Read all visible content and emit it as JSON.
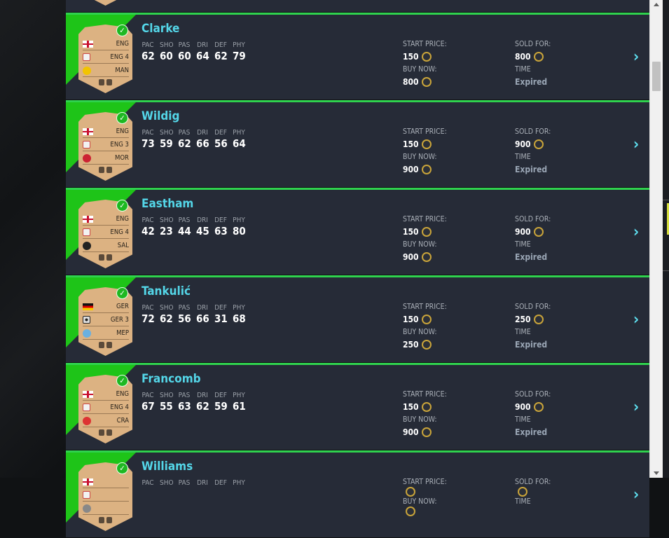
{
  "labels": {
    "stats": [
      "PAC",
      "SHO",
      "PAS",
      "DRI",
      "DEF",
      "PHY"
    ],
    "start_price": "START PRICE:",
    "buy_now": "BUY NOW:",
    "sold_for": "SOLD FOR:",
    "time": "TIME"
  },
  "players": [
    {
      "name": "",
      "nation": "",
      "league": "",
      "club": "",
      "stats": [
        "",
        "",
        "",
        "",
        "",
        ""
      ],
      "start": "",
      "buy": "",
      "sold": "",
      "time": ""
    },
    {
      "name": "Clarke",
      "nation": "ENG",
      "league": "ENG 4",
      "club": "MAN",
      "stats": [
        "62",
        "60",
        "60",
        "64",
        "62",
        "79"
      ],
      "start": "150",
      "buy": "800",
      "sold": "800",
      "time": "Expired"
    },
    {
      "name": "Wildig",
      "nation": "ENG",
      "league": "ENG 3",
      "club": "MOR",
      "stats": [
        "73",
        "59",
        "62",
        "66",
        "56",
        "64"
      ],
      "start": "150",
      "buy": "900",
      "sold": "900",
      "time": "Expired"
    },
    {
      "name": "Eastham",
      "nation": "ENG",
      "league": "ENG 4",
      "club": "SAL",
      "stats": [
        "42",
        "23",
        "44",
        "45",
        "63",
        "80"
      ],
      "start": "150",
      "buy": "900",
      "sold": "900",
      "time": "Expired"
    },
    {
      "name": "Tankulić",
      "nation": "GER",
      "league": "GER 3",
      "club": "MEP",
      "stats": [
        "72",
        "62",
        "56",
        "66",
        "31",
        "68"
      ],
      "start": "150",
      "buy": "250",
      "sold": "250",
      "time": "Expired"
    },
    {
      "name": "Francomb",
      "nation": "ENG",
      "league": "ENG 4",
      "club": "CRA",
      "stats": [
        "67",
        "55",
        "63",
        "62",
        "59",
        "61"
      ],
      "start": "150",
      "buy": "900",
      "sold": "900",
      "time": "Expired"
    },
    {
      "name": "Williams",
      "nation": "",
      "league": "",
      "club": "",
      "stats": [
        "",
        "",
        "",
        "",
        "",
        ""
      ],
      "start": "",
      "buy": "",
      "sold": "",
      "time": ""
    }
  ],
  "colors": {
    "accent": "#54d6e8",
    "green": "#1ec418",
    "row_bg": "#262b37",
    "card": "#dcb282",
    "coin": "#c9a43a"
  }
}
